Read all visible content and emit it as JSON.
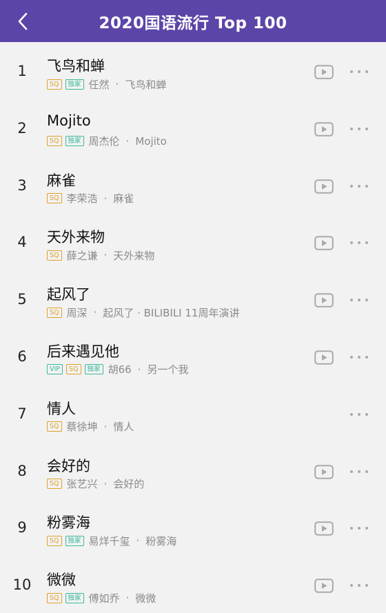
{
  "header": {
    "title": "2020国语流行 Top 100",
    "back_icon": "chevron-left-icon"
  },
  "colors": {
    "header_bg": "#5c45a8",
    "sq_badge": "#e0a12b",
    "exclusive_badge": "#3bb89c",
    "background": "#f2f2f2"
  },
  "songs": [
    {
      "rank": "1",
      "title": "飞鸟和蝉",
      "badges": [
        "SQ",
        "独家"
      ],
      "artist": "任然",
      "album": "飞鸟和蝉",
      "has_play": true
    },
    {
      "rank": "2",
      "title": "Mojito",
      "badges": [
        "SQ",
        "独家"
      ],
      "artist": "周杰伦",
      "album": "Mojito",
      "has_play": true
    },
    {
      "rank": "3",
      "title": "麻雀",
      "badges": [
        "SQ"
      ],
      "artist": "李荣浩",
      "album": "麻雀",
      "has_play": true
    },
    {
      "rank": "4",
      "title": "天外来物",
      "badges": [
        "SQ"
      ],
      "artist": "薛之谦",
      "album": "天外来物",
      "has_play": true
    },
    {
      "rank": "5",
      "title": "起风了",
      "badges": [
        "SQ"
      ],
      "artist": "周深",
      "album": "起风了 · BILIBILI 11周年演讲",
      "has_play": true
    },
    {
      "rank": "6",
      "title": "后来遇见他",
      "badges": [
        "VIP",
        "SQ",
        "独家"
      ],
      "artist": "胡66",
      "album": "另一个我",
      "has_play": true
    },
    {
      "rank": "7",
      "title": "情人",
      "badges": [
        "SQ"
      ],
      "artist": "蔡徐坤",
      "album": "情人",
      "has_play": false
    },
    {
      "rank": "8",
      "title": "会好的",
      "badges": [
        "SQ"
      ],
      "artist": "张艺兴",
      "album": "会好的",
      "has_play": true
    },
    {
      "rank": "9",
      "title": "粉雾海",
      "badges": [
        "SQ",
        "独家"
      ],
      "artist": "易烊千玺",
      "album": "粉雾海",
      "has_play": true
    },
    {
      "rank": "10",
      "title": "微微",
      "badges": [
        "SQ",
        "独家"
      ],
      "artist": "傅如乔",
      "album": "微微",
      "has_play": true
    }
  ],
  "separator": "·",
  "icons": {
    "play": "play-video-icon",
    "more": "more-dots-icon"
  }
}
